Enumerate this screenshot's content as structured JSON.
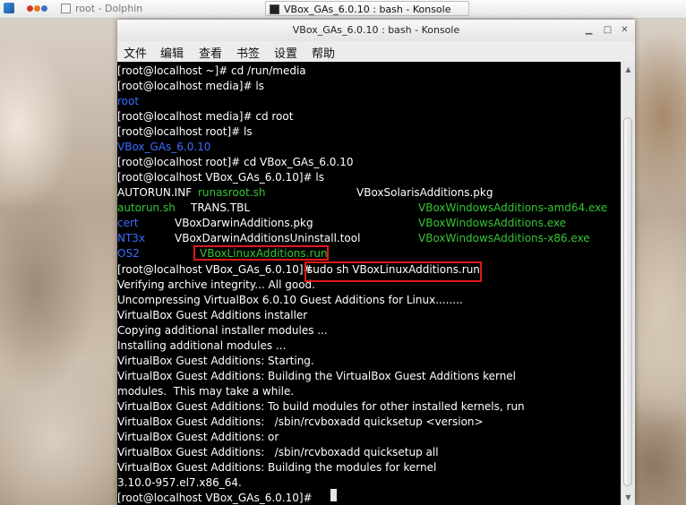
{
  "taskbar": {
    "tasks": [
      {
        "label": "root - Dolphin"
      },
      {
        "label": "VBox_GAs_6.0.10 : bash - Konsole"
      }
    ]
  },
  "window": {
    "title": "VBox_GAs_6.0.10 : bash - Konsole",
    "menu": [
      "文件",
      "编辑",
      "查看",
      "书签",
      "设置",
      "帮助"
    ]
  },
  "terminal": {
    "lines": [
      [
        "[root@localhost ~]# cd /run/media"
      ],
      [
        "[root@localhost media]# ls"
      ],
      [
        "root"
      ],
      [
        "[root@localhost media]# cd root"
      ],
      [
        "[root@localhost root]# ls"
      ],
      [
        "VBox_GAs_6.0.10"
      ],
      [
        "[root@localhost root]# cd VBox_GAs_6.0.10"
      ],
      [
        "[root@localhost VBox_GAs_6.0.10]# ls"
      ],
      [
        "AUTORUN.INF",
        "runasroot.sh",
        "VBoxSolarisAdditions.pkg"
      ],
      [
        "autorun.sh",
        "TRANS.TBL",
        "VBoxWindowsAdditions-amd64.exe"
      ],
      [
        "cert",
        "VBoxDarwinAdditions.pkg",
        "VBoxWindowsAdditions.exe"
      ],
      [
        "NT3x",
        "VBoxDarwinAdditionsUninstall.tool",
        "VBoxWindowsAdditions-x86.exe"
      ],
      [
        "OS2",
        "VBoxLinuxAdditions.run"
      ],
      [
        "[root@localhost VBox_GAs_6.0.10]#",
        "sudo sh VBoxLinuxAdditions.run"
      ],
      [
        "Verifying archive integrity... All good."
      ],
      [
        "Uncompressing VirtualBox 6.0.10 Guest Additions for Linux........"
      ],
      [
        "VirtualBox Guest Additions installer"
      ],
      [
        "Copying additional installer modules ..."
      ],
      [
        "Installing additional modules ..."
      ],
      [
        "VirtualBox Guest Additions: Starting."
      ],
      [
        "VirtualBox Guest Additions: Building the VirtualBox Guest Additions kernel"
      ],
      [
        "modules.  This may take a while."
      ],
      [
        "VirtualBox Guest Additions: To build modules for other installed kernels, run"
      ],
      [
        "VirtualBox Guest Additions:   /sbin/rcvboxadd quicksetup <version>"
      ],
      [
        "VirtualBox Guest Additions: or"
      ],
      [
        "VirtualBox Guest Additions:   /sbin/rcvboxadd quicksetup all"
      ],
      [
        "VirtualBox Guest Additions: Building the modules for kernel"
      ],
      [
        "3.10.0-957.el7.x86_64."
      ],
      [
        "[root@localhost VBox_GAs_6.0.10]#"
      ]
    ]
  },
  "colors": {
    "dir_blue": "#3c6cff",
    "exec_green": "#36c536",
    "highlight_red": "#e01919",
    "terminal_bg": "#000000"
  }
}
